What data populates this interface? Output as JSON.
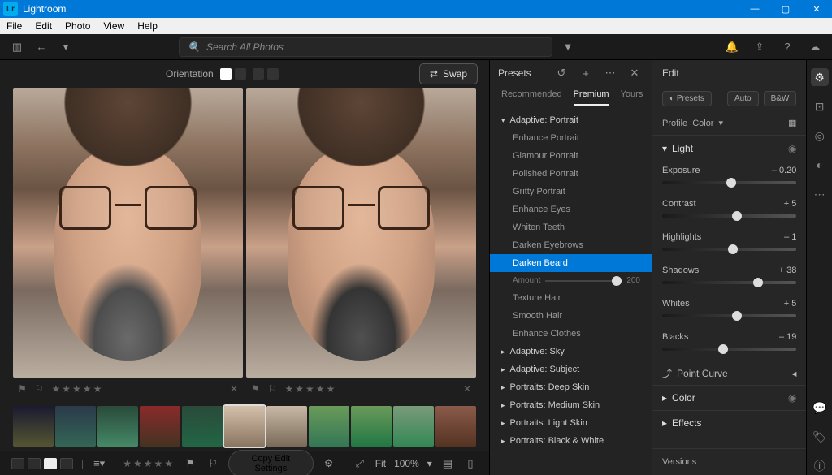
{
  "titlebar": {
    "app_name": "Lightroom"
  },
  "menubar": [
    "File",
    "Edit",
    "Photo",
    "View",
    "Help"
  ],
  "toprow": {
    "search_placeholder": "Search All Photos"
  },
  "viewer": {
    "orientation_label": "Orientation",
    "swap_label": "Swap"
  },
  "presets_panel": {
    "title": "Presets",
    "tabs": [
      "Recommended",
      "Premium",
      "Yours"
    ],
    "active_tab": 1,
    "expanded_group": "Adaptive: Portrait",
    "adaptive_portrait_items": [
      "Enhance Portrait",
      "Glamour Portrait",
      "Polished Portrait",
      "Gritty Portrait",
      "Enhance Eyes",
      "Whiten Teeth",
      "Darken Eyebrows",
      "Darken Beard"
    ],
    "selected_item": "Darken Beard",
    "amount_label": "Amount",
    "amount_value": "200",
    "post_items": [
      "Texture Hair",
      "Smooth Hair",
      "Enhance Clothes"
    ],
    "collapsed_groups": [
      "Adaptive: Sky",
      "Adaptive: Subject",
      "Portraits: Deep Skin",
      "Portraits: Medium Skin",
      "Portraits: Light Skin",
      "Portraits: Black & White"
    ]
  },
  "edit_panel": {
    "title": "Edit",
    "presets_btn": "Presets",
    "auto_btn": "Auto",
    "bw_btn": "B&W",
    "profile_label": "Profile",
    "profile_value": "Color",
    "light_label": "Light",
    "sliders": [
      {
        "name": "Exposure",
        "value": "– 0.20",
        "pos": 48
      },
      {
        "name": "Contrast",
        "value": "+ 5",
        "pos": 52
      },
      {
        "name": "Highlights",
        "value": "– 1",
        "pos": 49
      },
      {
        "name": "Shadows",
        "value": "+ 38",
        "pos": 68
      },
      {
        "name": "Whites",
        "value": "+ 5",
        "pos": 52
      },
      {
        "name": "Blacks",
        "value": "– 19",
        "pos": 42
      }
    ],
    "point_curve": "Point Curve",
    "color_label": "Color",
    "effects_label": "Effects",
    "versions_label": "Versions"
  },
  "bottombar": {
    "copy_label": "Copy Edit Settings",
    "fit_label": "Fit",
    "zoom_label": "100%"
  }
}
